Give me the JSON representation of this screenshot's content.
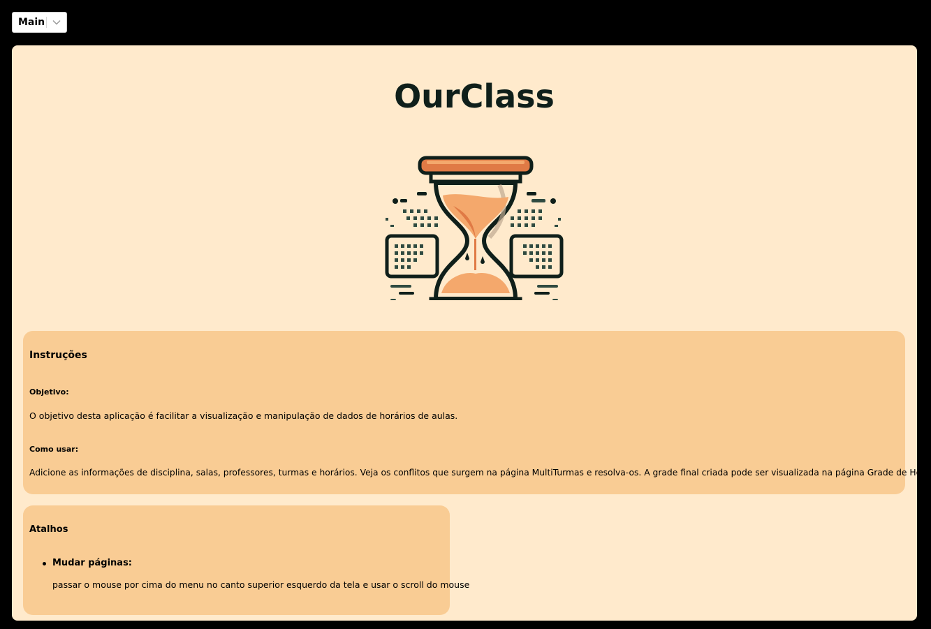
{
  "nav": {
    "selected_page": "Main"
  },
  "logo": {
    "title": "OurClass",
    "icon": "hourglass-icon",
    "colors": {
      "dark": "#0f1f1a",
      "orange": "#e07a45",
      "sand": "#f4a86c"
    }
  },
  "instrucoes": {
    "title": "Instruções",
    "objetivo_label": "Objetivo:",
    "objetivo_text": "O objetivo desta aplicação é facilitar a visualização e manipulação de dados de horários de aulas.",
    "como_usar_label": "Como usar:",
    "como_usar_text": "Adicione as informações de disciplina, salas, professores, turmas e horários. Veja os conflitos que surgem na página MultiTurmas e resolva-os. A grade final criada pode ser visualizada na página Grade de Horários."
  },
  "atalhos": {
    "title": "Atalhos",
    "items": [
      {
        "label": "Mudar páginas:",
        "text": "passar o mouse por cima do menu no canto superior esquerdo da tela e usar o scroll do mouse"
      }
    ]
  },
  "colors": {
    "background": "#000000",
    "card": "#ffeacc",
    "panel": "#f9cc94"
  }
}
